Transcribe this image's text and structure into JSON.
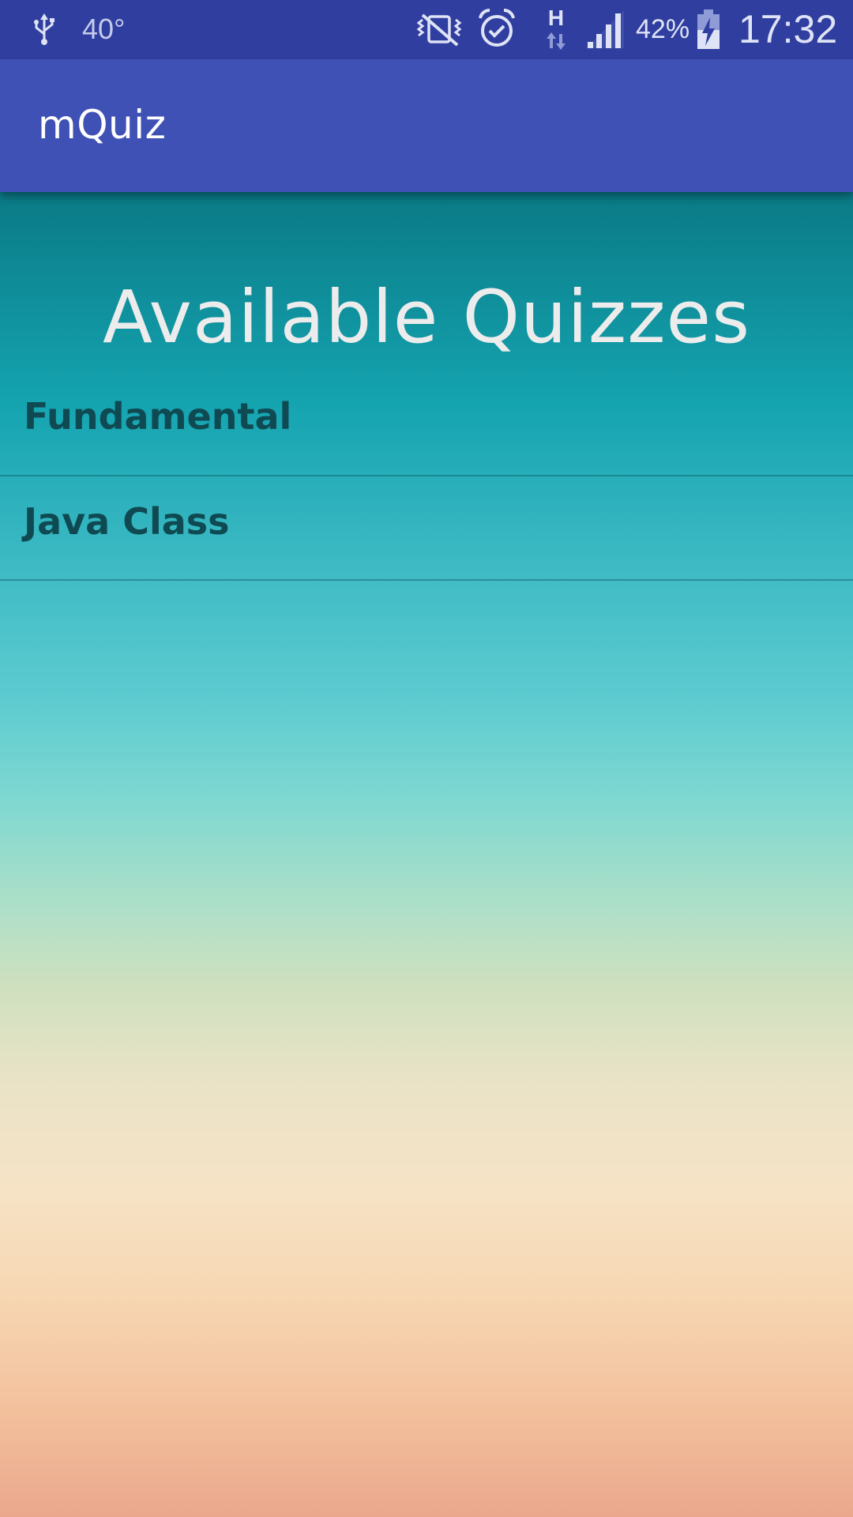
{
  "status_bar": {
    "temperature": "40°",
    "network_type": "H",
    "battery_percent": "42%",
    "time": "17:32",
    "icons": [
      "usb-icon",
      "vibrate-mute-icon",
      "alarm-icon",
      "network-data-icon",
      "signal-icon",
      "battery-charging-icon"
    ]
  },
  "app_bar": {
    "title": "mQuiz"
  },
  "main": {
    "heading": "Available Quizzes",
    "quizzes": [
      {
        "label": "Fundamental"
      },
      {
        "label": "Java Class"
      }
    ]
  },
  "colors": {
    "status_bar": "#303f9f",
    "app_bar": "#3f51b5",
    "list_text": "#0f4a53",
    "heading_text": "#ececec"
  }
}
